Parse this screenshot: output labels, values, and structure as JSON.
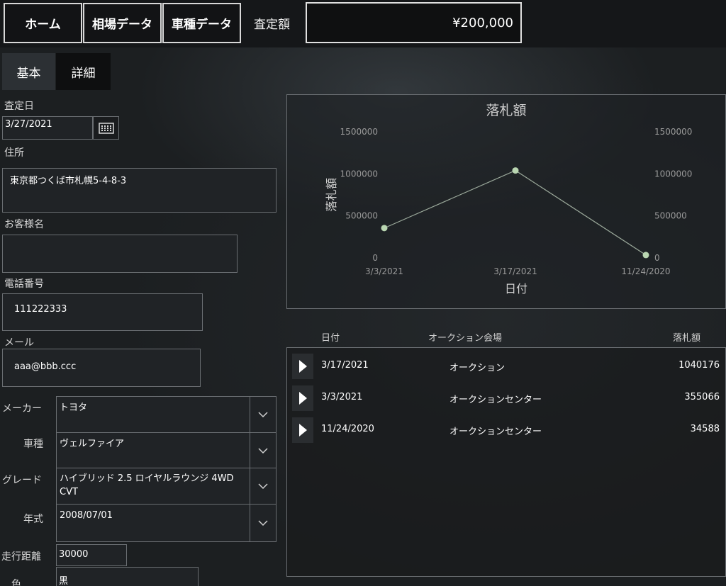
{
  "nav": {
    "home": "ホーム",
    "market_data": "相場データ",
    "model_data": "車種データ",
    "assessment_label": "査定額",
    "assessment_value": "¥200,000"
  },
  "tabs": {
    "basic": "基本",
    "detail": "詳細"
  },
  "form": {
    "date_label": "査定日",
    "date_value": "3/27/2021",
    "address_label": "住所",
    "address_value": "東京都つくば市札幌5-4-8-3",
    "customer_label": "お客様名",
    "customer_value": "",
    "phone_label": "電話番号",
    "phone_value": "111222333",
    "mail_label": "メール",
    "mail_value": "aaa@bbb.ccc",
    "maker_label": "メーカー",
    "maker_value": "トヨタ",
    "model_label": "車種",
    "model_value": "ヴェルファイア",
    "grade_label": "グレード",
    "grade_value": "ハイブリッド 2.5 ロイヤルラウンジ 4WD CVT",
    "year_label": "年式",
    "year_value": "2008/07/01",
    "mileage_label": "走行距離",
    "mileage_value": "30000",
    "color_label": "色",
    "color_value": "黒"
  },
  "chart_data": {
    "type": "line",
    "title": "落札額",
    "xlabel": "日付",
    "ylabel": "落札額",
    "categories": [
      "3/3/2021",
      "3/17/2021",
      "11/24/2020"
    ],
    "series": [
      {
        "values": [
          355066,
          1040176,
          34588
        ]
      }
    ],
    "ylim": [
      0,
      1500000
    ],
    "yticks": [
      "0",
      "500000",
      "1000000",
      "1500000"
    ],
    "grid": false,
    "colors": {
      "line": "#9aa89a",
      "point": "#b9d6b1"
    }
  },
  "table": {
    "headers": {
      "date": "日付",
      "venue": "オークション会場",
      "price": "落札額"
    },
    "rows": [
      {
        "date": "3/17/2021",
        "venue": "オークション",
        "price": "1040176"
      },
      {
        "date": "3/3/2021",
        "venue": "オークションセンター",
        "price": "355066"
      },
      {
        "date": "11/24/2020",
        "venue": "オークションセンター",
        "price": "34588"
      }
    ]
  }
}
